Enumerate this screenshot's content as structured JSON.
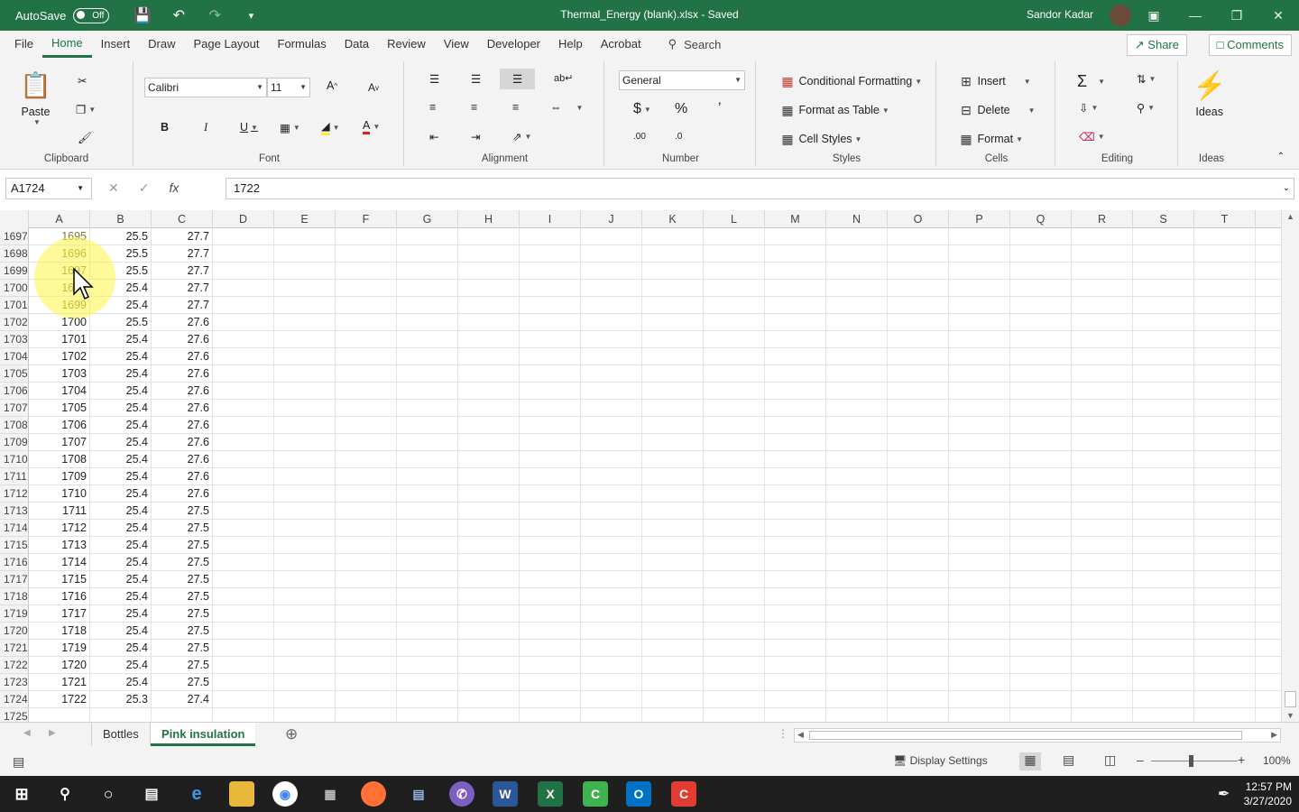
{
  "titlebar": {
    "autosave_label": "AutoSave",
    "autosave_state": "Off",
    "title": "Thermal_Energy (blank).xlsx  -  Saved",
    "user": "Sandor Kadar"
  },
  "menu": {
    "items": [
      "File",
      "Home",
      "Insert",
      "Draw",
      "Page Layout",
      "Formulas",
      "Data",
      "Review",
      "View",
      "Developer",
      "Help",
      "Acrobat"
    ],
    "active": "Home",
    "search": "Search",
    "share": "Share",
    "comments": "Comments"
  },
  "ribbon": {
    "clipboard": {
      "label": "Clipboard",
      "paste": "Paste"
    },
    "font": {
      "label": "Font",
      "name": "Calibri",
      "size": "11"
    },
    "alignment": {
      "label": "Alignment"
    },
    "number": {
      "label": "Number",
      "format": "General"
    },
    "styles": {
      "label": "Styles",
      "conditional": "Conditional Formatting",
      "format_table": "Format as Table",
      "cell_styles": "Cell Styles"
    },
    "cells": {
      "label": "Cells",
      "insert": "Insert",
      "delete": "Delete",
      "format": "Format"
    },
    "editing": {
      "label": "Editing"
    },
    "ideas": {
      "label": "Ideas",
      "button": "Ideas"
    }
  },
  "formula_bar": {
    "name_box": "A1724",
    "formula": "1722"
  },
  "columns": [
    "A",
    "B",
    "C",
    "D",
    "E",
    "F",
    "G",
    "H",
    "I",
    "J",
    "K",
    "L",
    "M",
    "N",
    "O",
    "P",
    "Q",
    "R",
    "S",
    "T"
  ],
  "rows": [
    {
      "n": "1697",
      "a": "1695",
      "b": "25.5",
      "c": "27.7"
    },
    {
      "n": "1698",
      "a": "1696",
      "b": "25.5",
      "c": "27.7"
    },
    {
      "n": "1699",
      "a": "1697",
      "b": "25.5",
      "c": "27.7"
    },
    {
      "n": "1700",
      "a": "1698",
      "b": "25.4",
      "c": "27.7"
    },
    {
      "n": "1701",
      "a": "1699",
      "b": "25.4",
      "c": "27.7"
    },
    {
      "n": "1702",
      "a": "1700",
      "b": "25.5",
      "c": "27.6"
    },
    {
      "n": "1703",
      "a": "1701",
      "b": "25.4",
      "c": "27.6"
    },
    {
      "n": "1704",
      "a": "1702",
      "b": "25.4",
      "c": "27.6"
    },
    {
      "n": "1705",
      "a": "1703",
      "b": "25.4",
      "c": "27.6"
    },
    {
      "n": "1706",
      "a": "1704",
      "b": "25.4",
      "c": "27.6"
    },
    {
      "n": "1707",
      "a": "1705",
      "b": "25.4",
      "c": "27.6"
    },
    {
      "n": "1708",
      "a": "1706",
      "b": "25.4",
      "c": "27.6"
    },
    {
      "n": "1709",
      "a": "1707",
      "b": "25.4",
      "c": "27.6"
    },
    {
      "n": "1710",
      "a": "1708",
      "b": "25.4",
      "c": "27.6"
    },
    {
      "n": "1711",
      "a": "1709",
      "b": "25.4",
      "c": "27.6"
    },
    {
      "n": "1712",
      "a": "1710",
      "b": "25.4",
      "c": "27.6"
    },
    {
      "n": "1713",
      "a": "1711",
      "b": "25.4",
      "c": "27.5"
    },
    {
      "n": "1714",
      "a": "1712",
      "b": "25.4",
      "c": "27.5"
    },
    {
      "n": "1715",
      "a": "1713",
      "b": "25.4",
      "c": "27.5"
    },
    {
      "n": "1716",
      "a": "1714",
      "b": "25.4",
      "c": "27.5"
    },
    {
      "n": "1717",
      "a": "1715",
      "b": "25.4",
      "c": "27.5"
    },
    {
      "n": "1718",
      "a": "1716",
      "b": "25.4",
      "c": "27.5"
    },
    {
      "n": "1719",
      "a": "1717",
      "b": "25.4",
      "c": "27.5"
    },
    {
      "n": "1720",
      "a": "1718",
      "b": "25.4",
      "c": "27.5"
    },
    {
      "n": "1721",
      "a": "1719",
      "b": "25.4",
      "c": "27.5"
    },
    {
      "n": "1722",
      "a": "1720",
      "b": "25.4",
      "c": "27.5"
    },
    {
      "n": "1723",
      "a": "1721",
      "b": "25.4",
      "c": "27.5"
    },
    {
      "n": "1724",
      "a": "1722",
      "b": "25.3",
      "c": "27.4"
    },
    {
      "n": "1725",
      "a": "",
      "b": "",
      "c": ""
    }
  ],
  "sheets": [
    "Bottles",
    "Pink insulation"
  ],
  "active_sheet": "Pink insulation",
  "status": {
    "display_settings": "Display Settings",
    "zoom": "100%"
  },
  "taskbar": {
    "time": "12:57 PM",
    "date": "3/27/2020"
  },
  "colors": {
    "accent": "#217346",
    "highlight": "#fff546"
  }
}
